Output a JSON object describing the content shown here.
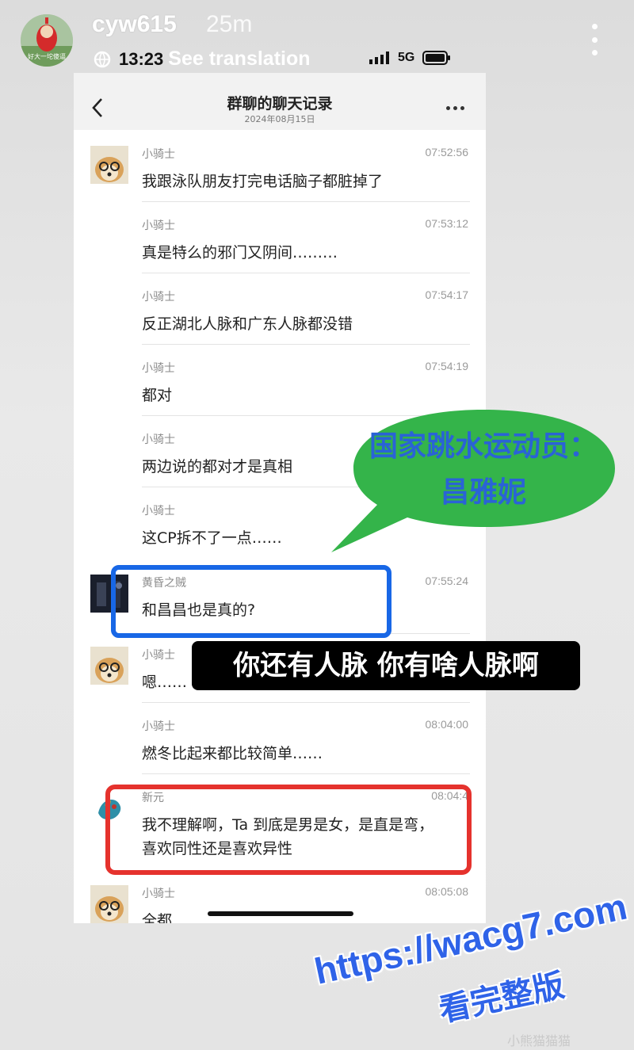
{
  "story": {
    "username": "cyw615",
    "time_ago": "25m",
    "see_translation": "See translation",
    "clock": "13:23",
    "network": "5G",
    "avatar_caption": "好大一坨傻逼"
  },
  "chat": {
    "title": "群聊的聊天记录",
    "date": "2024年08月15日",
    "messages": [
      {
        "sender": "小骑士",
        "time": "07:52:56",
        "text": "我跟泳队朋友打完电话脑子都脏掉了",
        "avatar": "shiba"
      },
      {
        "sender": "小骑士",
        "time": "07:53:12",
        "text": "真是特么的邪门又阴间………",
        "avatar": ""
      },
      {
        "sender": "小骑士",
        "time": "07:54:17",
        "text": "反正湖北人脉和广东人脉都没错",
        "avatar": ""
      },
      {
        "sender": "小骑士",
        "time": "07:54:19",
        "text": "都对",
        "avatar": ""
      },
      {
        "sender": "小骑士",
        "time": "",
        "text": "两边说的都对才是真相",
        "avatar": ""
      },
      {
        "sender": "小骑士",
        "time": "",
        "text": "这CP拆不了一点……",
        "avatar": ""
      },
      {
        "sender": "黄昏之贼",
        "time": "07:55:24",
        "text": "和昌昌也是真的?",
        "avatar": "dark"
      },
      {
        "sender": "小骑士",
        "time": "",
        "text": "嗯……",
        "avatar": "shiba"
      },
      {
        "sender": "小骑士",
        "time": "08:04:00",
        "text": "燃冬比起来都比较简单……",
        "avatar": ""
      },
      {
        "sender": "新元",
        "time": "08:04:4",
        "text": "我不理解啊，Ta 到底是男是女，是直是弯，",
        "text2": "喜欢同性还是喜欢异性",
        "avatar": "dragon"
      },
      {
        "sender": "小骑士",
        "time": "08:05:08",
        "text": "全都",
        "avatar": "shiba"
      }
    ]
  },
  "overlay": {
    "bubble_line1": "国家跳水运动员：",
    "bubble_line2": "昌雅妮",
    "caption": "你还有人脉 你有啥人脉啊",
    "watermark_url": "https://wacg7.com",
    "watermark_cn": "看完整版",
    "faint_text": "小熊猫猫猫"
  },
  "colors": {
    "bubble_fill": "#34b44a",
    "bubble_text": "#2a63d6",
    "blue_box": "#1867e6",
    "red_box": "#e5322d"
  }
}
